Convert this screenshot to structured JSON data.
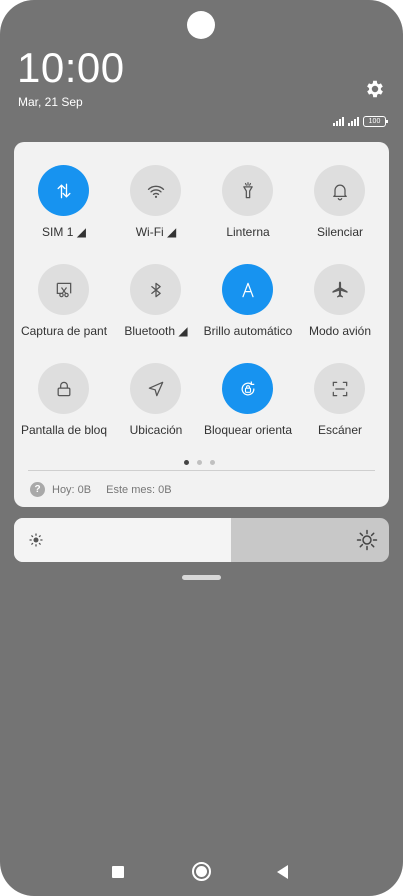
{
  "status_bar": {
    "time": "10:00",
    "date": "Mar, 21 Sep",
    "battery": "100",
    "icons": [
      "signal-sim1-icon",
      "signal-sim2-icon",
      "battery-icon"
    ]
  },
  "quick_settings": {
    "tiles": [
      {
        "label": "SIM 1 ◢",
        "icon": "data-transfer-icon",
        "active": true
      },
      {
        "label": "Wi-Fi ◢",
        "icon": "wifi-icon",
        "active": false
      },
      {
        "label": "Linterna",
        "icon": "flashlight-icon",
        "active": false
      },
      {
        "label": "Silenciar",
        "icon": "bell-icon",
        "active": false
      },
      {
        "label": "Captura de pant",
        "icon": "screenshot-icon",
        "active": false
      },
      {
        "label": "Bluetooth ◢",
        "icon": "bluetooth-icon",
        "active": false
      },
      {
        "label": "Brillo automático",
        "icon": "auto-brightness-icon",
        "active": true
      },
      {
        "label": "Modo avión",
        "icon": "airplane-icon",
        "active": false
      },
      {
        "label": "Pantalla de bloq",
        "icon": "lock-icon",
        "active": false
      },
      {
        "label": "Ubicación",
        "icon": "location-icon",
        "active": false
      },
      {
        "label": "Bloquear orienta",
        "icon": "rotation-lock-icon",
        "active": true
      },
      {
        "label": "Escáner",
        "icon": "scanner-icon",
        "active": false
      }
    ],
    "page_indicator": {
      "pages": 3,
      "current": 1
    },
    "data_usage": {
      "today": "Hoy: 0B",
      "month": "Este mes: 0B"
    }
  },
  "brightness": {
    "level": 0.58
  },
  "colors": {
    "background": "#747474",
    "panel": "#f2f2f2",
    "accent": "#1793f0",
    "tile_inactive": "#dedede"
  },
  "navigation": [
    "recents-button",
    "home-button",
    "back-button"
  ]
}
